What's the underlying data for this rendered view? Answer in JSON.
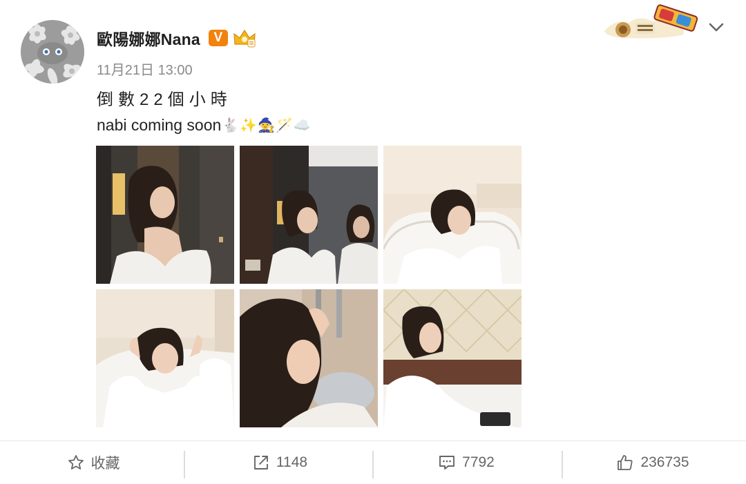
{
  "post": {
    "author": "歐陽娜娜Nana",
    "verified_badge": "V",
    "time": "11月21日 13:00",
    "text_line1": "倒數22個小時",
    "text_line2": "nabi coming soon",
    "emojis": [
      "🐇",
      "✨",
      "🧙",
      "🪄",
      "☁️"
    ],
    "photo_count": 6
  },
  "icons": {
    "more": "chevron-down-icon",
    "favorite": "star-icon",
    "repost": "share-icon",
    "comment": "comment-icon",
    "like": "thumbs-up-icon"
  },
  "actions": {
    "favorite_label": "收藏",
    "repost_count": "1148",
    "comment_count": "7792",
    "like_count": "236735"
  },
  "colors": {
    "badge_orange": "#f2820d",
    "text_gray": "#8a8a8a",
    "action_gray": "#666666"
  }
}
